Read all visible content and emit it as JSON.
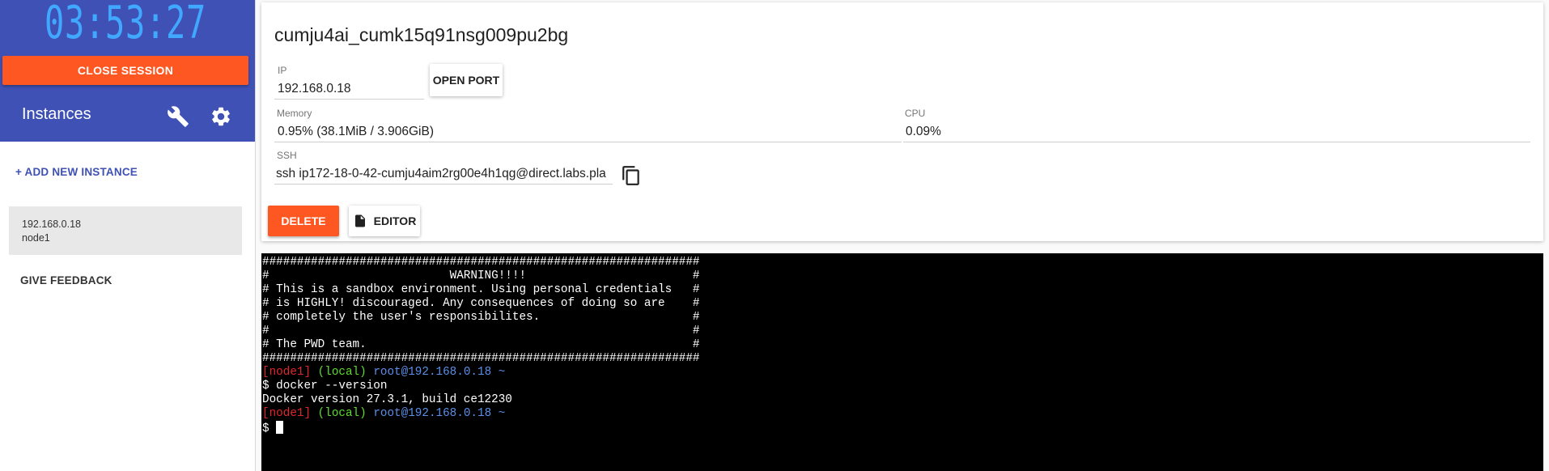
{
  "session": {
    "timer": "03:53:27",
    "close_label": "CLOSE SESSION"
  },
  "sidebar": {
    "title": "Instances",
    "add_instance_label": "+ ADD NEW INSTANCE",
    "instances": [
      {
        "ip": "192.168.0.18",
        "name": "node1"
      }
    ],
    "feedback_label": "GIVE FEEDBACK"
  },
  "instance": {
    "title": "cumju4ai_cumk15q91nsg009pu2bg",
    "ip_label": "IP",
    "ip_value": "192.168.0.18",
    "open_port_label": "OPEN PORT",
    "memory_label": "Memory",
    "memory_value": "0.95% (38.1MiB / 3.906GiB)",
    "cpu_label": "CPU",
    "cpu_value": "0.09%",
    "ssh_label": "SSH",
    "ssh_value": "ssh ip172-18-0-42-cumju4aim2rg00e4h1qg@direct.labs.pla",
    "delete_label": "DELETE",
    "editor_label": "EDITOR"
  },
  "terminal": {
    "banner": [
      "###############################################################",
      "#                          WARNING!!!!                        #",
      "# This is a sandbox environment. Using personal credentials   #",
      "# is HIGHLY! discouraged. Any consequences of doing so are    #",
      "# completely the user's responsibilites.                      #",
      "#                                                             #",
      "# The PWD team.                                               #",
      "###############################################################"
    ],
    "prompt_node": "[node1]",
    "prompt_local": "(local)",
    "prompt_host": "root@192.168.0.18 ~",
    "command": "$ docker --version",
    "output": "Docker version 27.3.1, build ce12230",
    "prompt_symbol": "$ "
  },
  "colors": {
    "primary": "#3f51b5",
    "accent": "#ff5722",
    "timer": "#40a9ff",
    "term_red": "#e0262c",
    "term_green": "#5ddc2e",
    "term_blue": "#5b8fe8"
  }
}
